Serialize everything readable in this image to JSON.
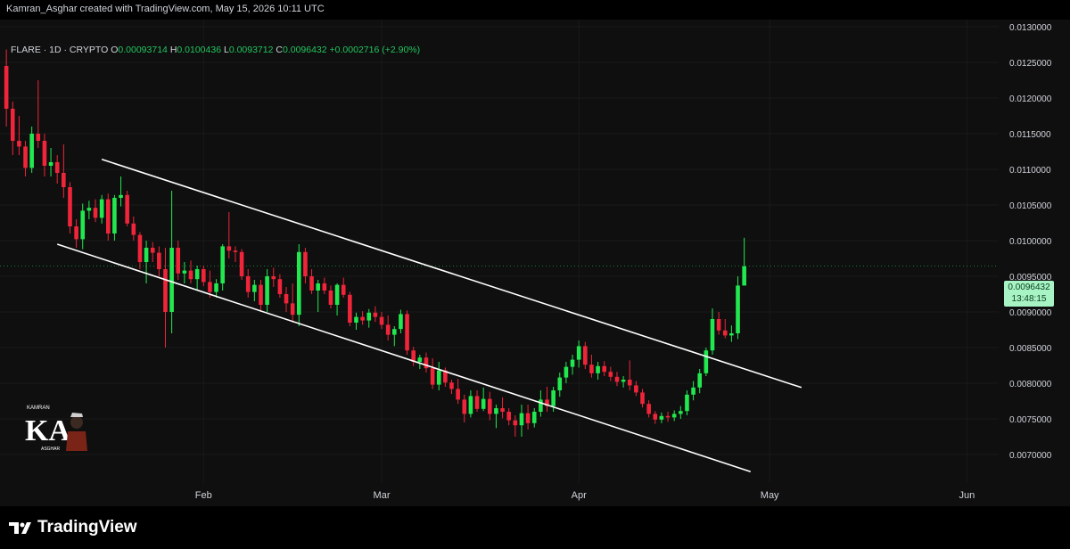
{
  "caption": "Kamran_Asghar created with TradingView.com, May 15, 2026 10:11 UTC",
  "legend": {
    "symbol": "FLARE · 1D · CRYPTO",
    "o_label": "O",
    "o": "0.00093714",
    "h_label": "H",
    "h": "0.0100436",
    "l_label": "L",
    "l": "0.0093712",
    "c_label": "C",
    "c": "0.0096432",
    "change": "+0.0002716 (+2.90%)"
  },
  "price_badge": {
    "price": "0.0096432",
    "countdown": "13:48:15"
  },
  "footer": {
    "brand": "TradingView"
  },
  "watermark": {
    "top_text": "KAMRAN",
    "initials": "KA",
    "bottom_text": "ASGHAR"
  },
  "colors": {
    "up": "#22e84f",
    "down": "#f0253a",
    "channel": "#ffffff",
    "badge_bg": "#a7f3c4",
    "grid": "#1a1a1a",
    "axis_text": "#d1d4dc"
  },
  "chart_data": {
    "type": "candlestick",
    "x_ticks": [
      "Feb",
      "Mar",
      "Apr",
      "May",
      "Jun"
    ],
    "x_tick_days": [
      32,
      60,
      91,
      121,
      152
    ],
    "y_ticks": [
      "0.0070000",
      "0.0075000",
      "0.0080000",
      "0.0085000",
      "0.0090000",
      "0.0095000",
      "0.0100000",
      "0.0105000",
      "0.0110000",
      "0.0115000",
      "0.0120000",
      "0.0125000",
      "0.0130000"
    ],
    "ylim": [
      0.0066,
      0.0131
    ],
    "xlim": [
      0,
      157
    ],
    "last_price": 0.0096432,
    "channel": {
      "upper": [
        [
          16,
          0.01114
        ],
        [
          126,
          0.00794
        ]
      ],
      "lower": [
        [
          9,
          0.00995
        ],
        [
          118,
          0.00676
        ]
      ]
    },
    "candles": [
      [
        0.01245,
        0.01268,
        0.0116,
        0.01185
      ],
      [
        0.01185,
        0.01195,
        0.0112,
        0.0114
      ],
      [
        0.0114,
        0.01175,
        0.0112,
        0.01132
      ],
      [
        0.01132,
        0.0114,
        0.0109,
        0.01102
      ],
      [
        0.01102,
        0.0116,
        0.01095,
        0.0115
      ],
      [
        0.0115,
        0.01225,
        0.0113,
        0.0114
      ],
      [
        0.0114,
        0.0115,
        0.0109,
        0.01105
      ],
      [
        0.01105,
        0.0113,
        0.0109,
        0.0111
      ],
      [
        0.0111,
        0.0112,
        0.0108,
        0.01095
      ],
      [
        0.01095,
        0.01135,
        0.0106,
        0.01075
      ],
      [
        0.01075,
        0.01082,
        0.0101,
        0.0102
      ],
      [
        0.0102,
        0.0103,
        0.0099,
        0.01002
      ],
      [
        0.01002,
        0.01052,
        0.00988,
        0.01042
      ],
      [
        0.01042,
        0.01056,
        0.0103,
        0.01046
      ],
      [
        0.01046,
        0.01058,
        0.01026,
        0.01032
      ],
      [
        0.01032,
        0.01064,
        0.01024,
        0.01058
      ],
      [
        0.01058,
        0.01066,
        0.01,
        0.0101
      ],
      [
        0.0101,
        0.01064,
        0.01,
        0.0106
      ],
      [
        0.0106,
        0.0109,
        0.01048,
        0.01064
      ],
      [
        0.01064,
        0.0107,
        0.0102,
        0.01024
      ],
      [
        0.01024,
        0.01034,
        0.01,
        0.01008
      ],
      [
        0.01008,
        0.01012,
        0.0096,
        0.0097
      ],
      [
        0.0097,
        0.01,
        0.0094,
        0.0099
      ],
      [
        0.0099,
        0.00998,
        0.0097,
        0.00983
      ],
      [
        0.00983,
        0.00992,
        0.0095,
        0.0096
      ],
      [
        0.0096,
        0.0099,
        0.0085,
        0.009
      ],
      [
        0.009,
        0.0107,
        0.0087,
        0.0099
      ],
      [
        0.0099,
        0.01,
        0.00945,
        0.00954
      ],
      [
        0.00954,
        0.0097,
        0.0094,
        0.00958
      ],
      [
        0.00958,
        0.00972,
        0.0094,
        0.00946
      ],
      [
        0.00946,
        0.00965,
        0.0093,
        0.0096
      ],
      [
        0.0096,
        0.00965,
        0.00936,
        0.00942
      ],
      [
        0.00942,
        0.00958,
        0.0092,
        0.00928
      ],
      [
        0.00928,
        0.00946,
        0.0092,
        0.0094
      ],
      [
        0.0094,
        0.00995,
        0.0093,
        0.00992
      ],
      [
        0.00992,
        0.0104,
        0.00975,
        0.00986
      ],
      [
        0.00986,
        0.00992,
        0.0097,
        0.00984
      ],
      [
        0.00984,
        0.00988,
        0.00945,
        0.0095
      ],
      [
        0.0095,
        0.0096,
        0.0092,
        0.00928
      ],
      [
        0.00928,
        0.00945,
        0.00915,
        0.00938
      ],
      [
        0.00938,
        0.00945,
        0.009,
        0.0091
      ],
      [
        0.0091,
        0.0096,
        0.009,
        0.0095
      ],
      [
        0.0095,
        0.00962,
        0.00935,
        0.00946
      ],
      [
        0.00946,
        0.00953,
        0.0092,
        0.00925
      ],
      [
        0.00925,
        0.00935,
        0.009,
        0.00912
      ],
      [
        0.00912,
        0.0094,
        0.00885,
        0.00896
      ],
      [
        0.00896,
        0.00995,
        0.0088,
        0.00984
      ],
      [
        0.00984,
        0.0099,
        0.0094,
        0.0095
      ],
      [
        0.0095,
        0.0096,
        0.00925,
        0.0093
      ],
      [
        0.0093,
        0.00945,
        0.009,
        0.0094
      ],
      [
        0.0094,
        0.00948,
        0.00925,
        0.0093
      ],
      [
        0.0093,
        0.00937,
        0.00905,
        0.0091
      ],
      [
        0.0091,
        0.0094,
        0.00895,
        0.00938
      ],
      [
        0.00938,
        0.00948,
        0.0092,
        0.00924
      ],
      [
        0.00924,
        0.00928,
        0.0088,
        0.00885
      ],
      [
        0.00885,
        0.00899,
        0.00875,
        0.00893
      ],
      [
        0.00893,
        0.00901,
        0.00882,
        0.00888
      ],
      [
        0.00888,
        0.00904,
        0.00878,
        0.00899
      ],
      [
        0.00899,
        0.00908,
        0.00886,
        0.00893
      ],
      [
        0.00893,
        0.009,
        0.00876,
        0.00882
      ],
      [
        0.00882,
        0.00895,
        0.0086,
        0.00868
      ],
      [
        0.00868,
        0.0088,
        0.00852,
        0.00876
      ],
      [
        0.00876,
        0.00903,
        0.0087,
        0.00897
      ],
      [
        0.00897,
        0.00902,
        0.0084,
        0.00846
      ],
      [
        0.00846,
        0.00851,
        0.00824,
        0.0083
      ],
      [
        0.0083,
        0.0084,
        0.0082,
        0.00836
      ],
      [
        0.00836,
        0.00843,
        0.00815,
        0.00821
      ],
      [
        0.00821,
        0.00835,
        0.00792,
        0.00798
      ],
      [
        0.00798,
        0.0083,
        0.0079,
        0.00818
      ],
      [
        0.00818,
        0.00822,
        0.00795,
        0.00801
      ],
      [
        0.00801,
        0.00805,
        0.00785,
        0.00792
      ],
      [
        0.00792,
        0.00806,
        0.00771,
        0.00777
      ],
      [
        0.00777,
        0.00784,
        0.00745,
        0.00757
      ],
      [
        0.00757,
        0.0079,
        0.00752,
        0.00782
      ],
      [
        0.00782,
        0.0079,
        0.0076,
        0.00764
      ],
      [
        0.00764,
        0.00794,
        0.00761,
        0.00778
      ],
      [
        0.00778,
        0.00788,
        0.00748,
        0.00757
      ],
      [
        0.00757,
        0.0077,
        0.00737,
        0.00765
      ],
      [
        0.00765,
        0.0078,
        0.00751,
        0.0076
      ],
      [
        0.0076,
        0.00765,
        0.00741,
        0.00748
      ],
      [
        0.00748,
        0.00755,
        0.00725,
        0.00741
      ],
      [
        0.00741,
        0.0077,
        0.00725,
        0.00758
      ],
      [
        0.00758,
        0.0077,
        0.00735,
        0.00744
      ],
      [
        0.00744,
        0.00765,
        0.00738,
        0.0076
      ],
      [
        0.0076,
        0.0079,
        0.00753,
        0.00777
      ],
      [
        0.00777,
        0.00795,
        0.0076,
        0.00768
      ],
      [
        0.00768,
        0.00795,
        0.0076,
        0.0079
      ],
      [
        0.0079,
        0.00815,
        0.00781,
        0.00808
      ],
      [
        0.00808,
        0.0083,
        0.008,
        0.00823
      ],
      [
        0.00823,
        0.0084,
        0.00812,
        0.00833
      ],
      [
        0.00833,
        0.0086,
        0.00822,
        0.00852
      ],
      [
        0.00852,
        0.00858,
        0.0082,
        0.00826
      ],
      [
        0.00826,
        0.0084,
        0.00808,
        0.00814
      ],
      [
        0.00814,
        0.0083,
        0.00805,
        0.00824
      ],
      [
        0.00824,
        0.00831,
        0.0081,
        0.00816
      ],
      [
        0.00816,
        0.00823,
        0.00803,
        0.00809
      ],
      [
        0.00809,
        0.00816,
        0.00796,
        0.00802
      ],
      [
        0.00802,
        0.0081,
        0.00794,
        0.00805
      ],
      [
        0.00805,
        0.00832,
        0.0079,
        0.00797
      ],
      [
        0.00797,
        0.00803,
        0.00782,
        0.00787
      ],
      [
        0.00787,
        0.00792,
        0.00766,
        0.00771
      ],
      [
        0.00771,
        0.00776,
        0.00752,
        0.00757
      ],
      [
        0.00757,
        0.00761,
        0.00743,
        0.00749
      ],
      [
        0.00749,
        0.00759,
        0.00744,
        0.00754
      ],
      [
        0.00754,
        0.0076,
        0.00746,
        0.00752
      ],
      [
        0.00752,
        0.00762,
        0.00747,
        0.00757
      ],
      [
        0.00757,
        0.00768,
        0.0075,
        0.00761
      ],
      [
        0.00761,
        0.0079,
        0.00755,
        0.00784
      ],
      [
        0.00784,
        0.00803,
        0.00776,
        0.00794
      ],
      [
        0.00794,
        0.0082,
        0.00786,
        0.00814
      ],
      [
        0.00814,
        0.0085,
        0.0081,
        0.00846
      ],
      [
        0.00846,
        0.00905,
        0.0084,
        0.0089
      ],
      [
        0.0089,
        0.009,
        0.00868,
        0.00874
      ],
      [
        0.00874,
        0.0089,
        0.00863,
        0.00867
      ],
      [
        0.00867,
        0.00881,
        0.00858,
        0.0087
      ],
      [
        0.0087,
        0.0095,
        0.00862,
        0.00937
      ],
      [
        0.00937,
        0.01004,
        0.00937,
        0.00964
      ]
    ]
  }
}
